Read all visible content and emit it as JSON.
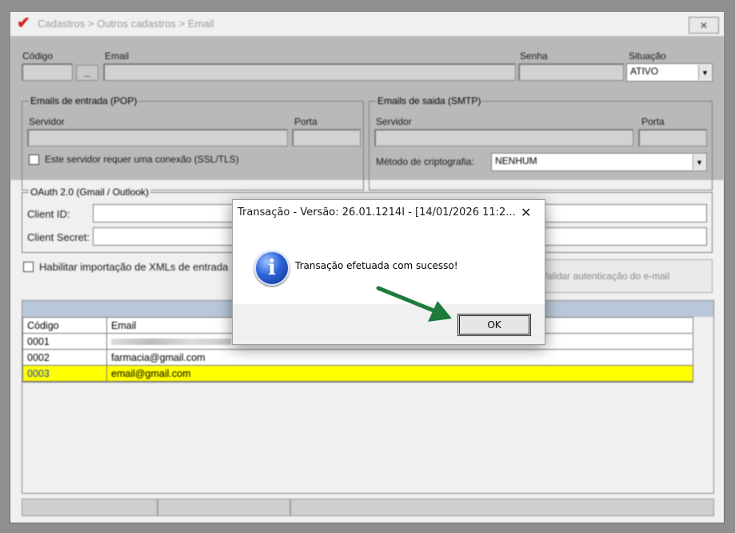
{
  "window": {
    "title": "Cadastros > Outros cadastros > Email",
    "close_glyph": "✕"
  },
  "form": {
    "codigo_label": "Código",
    "lookup_button": "...",
    "email_label": "Email",
    "senha_label": "Senha",
    "situacao_label": "Situação",
    "situacao_value": "ATIVO"
  },
  "pop": {
    "title": "Emails de entrada (POP)",
    "servidor_label": "Servidor",
    "porta_label": "Porta",
    "ssl_label": "Este servidor requer uma conexão (SSL/TLS)"
  },
  "smtp": {
    "title": "Emails de saida (SMTP)",
    "servidor_label": "Servidor",
    "porta_label": "Porta",
    "cripto_label": "Método de criptografia:",
    "cripto_value": "NENHUM"
  },
  "oauth": {
    "title": "OAuth 2.0 (Gmail / Outlook)",
    "client_id_label": "Client ID:",
    "client_secret_label": "Client Secret:",
    "auth_button": "Validar autenticação do e-mail"
  },
  "import_label": "Habilitar importação de XMLs de entrada",
  "table": {
    "columns": [
      "Código",
      "Email"
    ],
    "rows": [
      {
        "codigo": "0001",
        "email": ""
      },
      {
        "codigo": "0002",
        "email": "farmacia@gmail.com"
      },
      {
        "codigo": "0003",
        "email": "email@gmail.com"
      }
    ]
  },
  "dialog": {
    "title": "Transação - Versão: 26.01.1214I - [14/01/2026 11:2...",
    "close_glyph": "✕",
    "message": "Transação efetuada com sucesso!",
    "ok_label": "OK",
    "icon": "info-icon"
  },
  "colors": {
    "selected_row": "#ffff00",
    "arrow": "#1f7a3c"
  }
}
